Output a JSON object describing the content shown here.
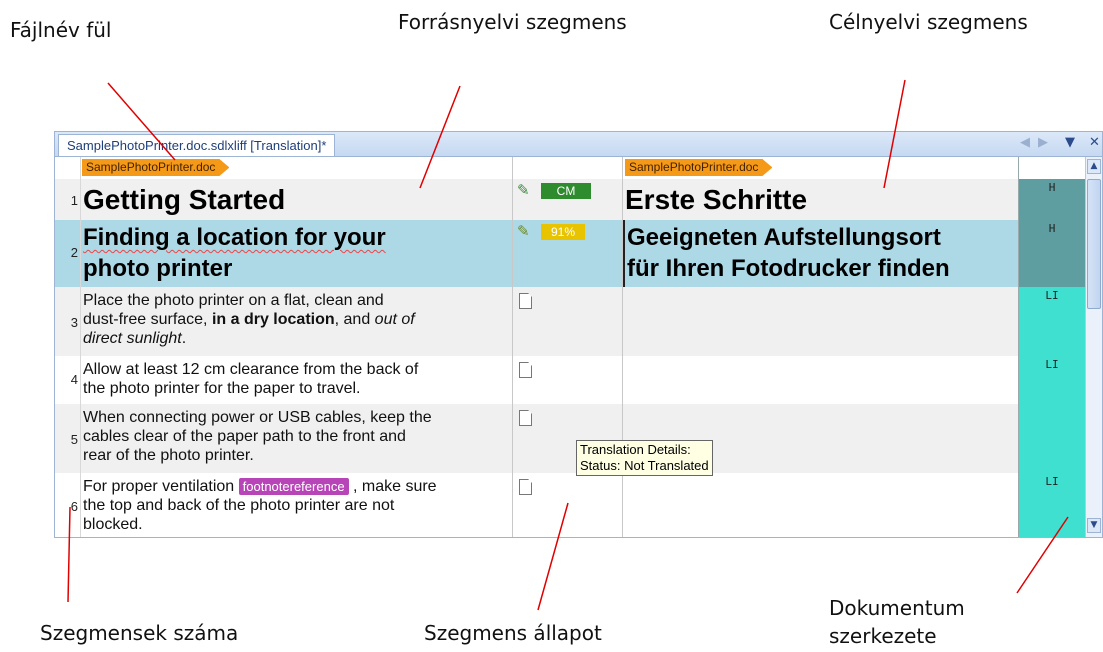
{
  "callouts": {
    "file_tab": "Fájlnév fül",
    "source_segment": "Forrásnyelvi szegmens",
    "target_segment": "Célnyelvi szegmens",
    "segment_numbers": "Szegmensek száma",
    "segment_status": "Szegmens állapot",
    "doc_structure_line1": "Dokumentum",
    "doc_structure_line2": "szerkezete"
  },
  "editor": {
    "tab_title": "SamplePhotoPrinter.doc.sdlxliff [Translation]*",
    "tab_controls": [
      "◀",
      "▶",
      "▼",
      "✕"
    ],
    "file_tag": "SamplePhotoPrinter.doc",
    "tooltip": {
      "line1": "Translation Details:",
      "line2": "Status: Not Translated"
    },
    "segments": [
      {
        "num": "1",
        "source": "Getting Started",
        "target": "Erste Schritte",
        "status_badge": "CM",
        "status_icon": "confirmed-pencil-icon",
        "structure": "H"
      },
      {
        "num": "2",
        "source_l1": "Finding a location for your",
        "source_l2": "photo printer",
        "target_l1": "Geeigneten Aufstellungsort",
        "target_l2": "für Ihren Fotodrucker finden",
        "status_badge": "91%",
        "status_icon": "draft-pencil-icon",
        "structure": "H"
      },
      {
        "num": "3",
        "src_a": "Place the photo printer on a flat, clean and",
        "src_b": "dust-free surface, ",
        "src_bold": "in a dry location",
        "src_c": ", and ",
        "src_italic1": "out of",
        "src_italic2": "direct sunlight",
        "src_d": ".",
        "target": "",
        "status_icon": "not-translated-icon",
        "structure": "LI"
      },
      {
        "num": "4",
        "src_l1": "Allow at least 12 cm clearance from the back of",
        "src_l2": "the photo printer for the paper to travel.",
        "target": "",
        "status_icon": "not-translated-icon",
        "structure": "LI"
      },
      {
        "num": "5",
        "src_l1": "When connecting power or USB cables, keep the",
        "src_l2": "cables clear of the paper path to the front and",
        "src_l3": "rear of the photo printer.",
        "target": "",
        "status_icon": "not-translated-icon",
        "structure": "LI"
      },
      {
        "num": "6",
        "src_a": "For proper ventilation ",
        "src_tag": "footnotereference",
        "src_b": " , make sure",
        "src_l2": "the top and back of the photo printer are not",
        "src_l3": "blocked.",
        "target": "",
        "status_icon": "not-translated-icon",
        "structure": "LI"
      }
    ]
  },
  "colors": {
    "header_row": "#add8e6",
    "structure_h": "#5f9ea0",
    "structure_li": "#40e0d0",
    "badge_cm": "#2e8b2e",
    "badge_fuzzy": "#e8c400",
    "alt_row": "#f0f0f0"
  }
}
